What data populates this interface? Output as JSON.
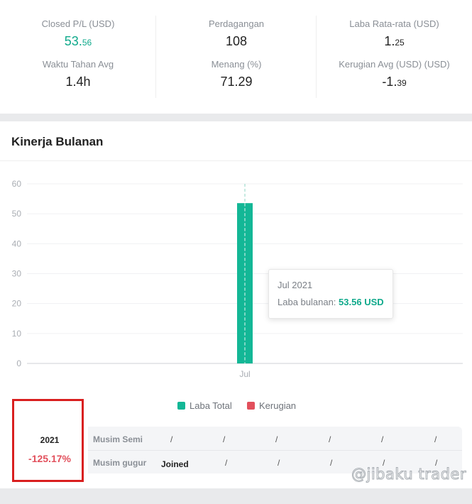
{
  "stats": [
    {
      "label": "Closed P/L (USD)",
      "value_main": "53.",
      "value_small": "56",
      "color": "#0fa98b"
    },
    {
      "label": "Perdagangan",
      "value_main": "108",
      "value_small": ""
    },
    {
      "label": "Laba Rata-rata (USD)",
      "value_main": "1.",
      "value_small": "25"
    },
    {
      "label": "Waktu Tahan Avg",
      "value_main": "1.4h",
      "value_small": ""
    },
    {
      "label": "Menang (%)",
      "value_main": "71.29",
      "value_small": ""
    },
    {
      "label": "Kerugian Avg (USD) (USD)",
      "value_main": "-1.",
      "value_small": "39"
    }
  ],
  "performance": {
    "title": "Kinerja Bulanan"
  },
  "chart_data": {
    "type": "bar",
    "categories": [
      "Jul"
    ],
    "series": [
      {
        "name": "Laba Total",
        "values": [
          53.56
        ],
        "color": "#13b796"
      },
      {
        "name": "Kerugian",
        "values": [
          0
        ],
        "color": "#e2505c"
      }
    ],
    "y_ticks": [
      0,
      10,
      20,
      30,
      40,
      50,
      60
    ],
    "ylim": [
      0,
      60
    ],
    "grid": true,
    "legend_position": "bottom-center"
  },
  "tooltip": {
    "title": "Jul 2021",
    "label": "Laba bulanan:",
    "value": "53.56 USD"
  },
  "legend": [
    {
      "label": "Laba Total",
      "color": "#13b796"
    },
    {
      "label": "Kerugian",
      "color": "#e2505c"
    }
  ],
  "seasons": {
    "year": "2021",
    "pct": "-125.17%",
    "rows": [
      {
        "label": "Musim Semi",
        "slots": [
          "/",
          "/",
          "/",
          "/",
          "/",
          "/"
        ]
      },
      {
        "label": "Musim gugur",
        "slots": [
          "Joined",
          "/",
          "/",
          "/",
          "/",
          "/"
        ]
      }
    ]
  },
  "watermark": "@jibaku trader"
}
